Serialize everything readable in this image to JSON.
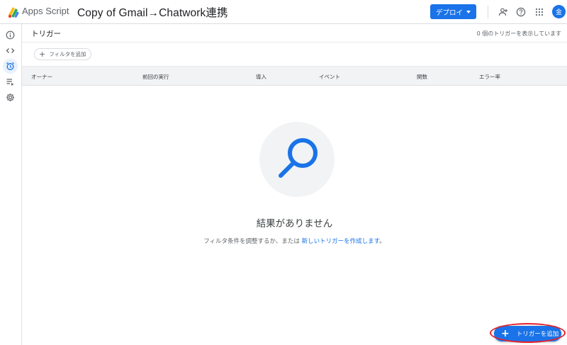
{
  "topbar": {
    "app_name": "Apps Script",
    "project_title": "Copy of Gmail→Chatwork連携",
    "deploy_label": "デプロイ",
    "avatar_letter": "金",
    "icons": [
      "add-person-icon",
      "help-icon",
      "apps-grid-icon"
    ]
  },
  "rail": {
    "items": [
      {
        "name": "overview",
        "icon": "info-icon"
      },
      {
        "name": "editor",
        "icon": "code-icon"
      },
      {
        "name": "triggers",
        "icon": "alarm-clock-icon",
        "active": true
      },
      {
        "name": "executions",
        "icon": "list-run-icon"
      },
      {
        "name": "settings",
        "icon": "gear-icon"
      }
    ]
  },
  "header": {
    "title": "トリガー",
    "count_text": "0 個のトリガーを表示しています"
  },
  "filter": {
    "label": "フィルタを追加"
  },
  "table": {
    "columns": [
      "オーナー",
      "前回の実行",
      "導入",
      "イベント",
      "関数",
      "エラー率"
    ]
  },
  "empty_state": {
    "title": "結果がありません",
    "subtitle_prefix": "フィルタ条件を調整するか、または ",
    "subtitle_link": "新しいトリガーを作成します",
    "subtitle_suffix": "。"
  },
  "fab": {
    "label": "トリガーを追加"
  },
  "colors": {
    "accent": "#1a73e8",
    "highlight_ring": "#e8202a"
  }
}
